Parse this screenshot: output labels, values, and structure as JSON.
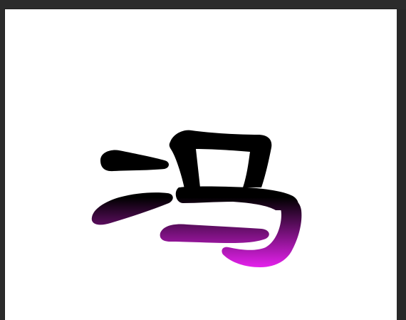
{
  "canvas": {
    "background": "#ffffff",
    "artwork": {
      "name": "calligraphy-character",
      "gradient": {
        "top_color": "#000000",
        "bottom_color": "#e020e8"
      }
    }
  },
  "workspace": {
    "background": "#2b2b2b"
  }
}
